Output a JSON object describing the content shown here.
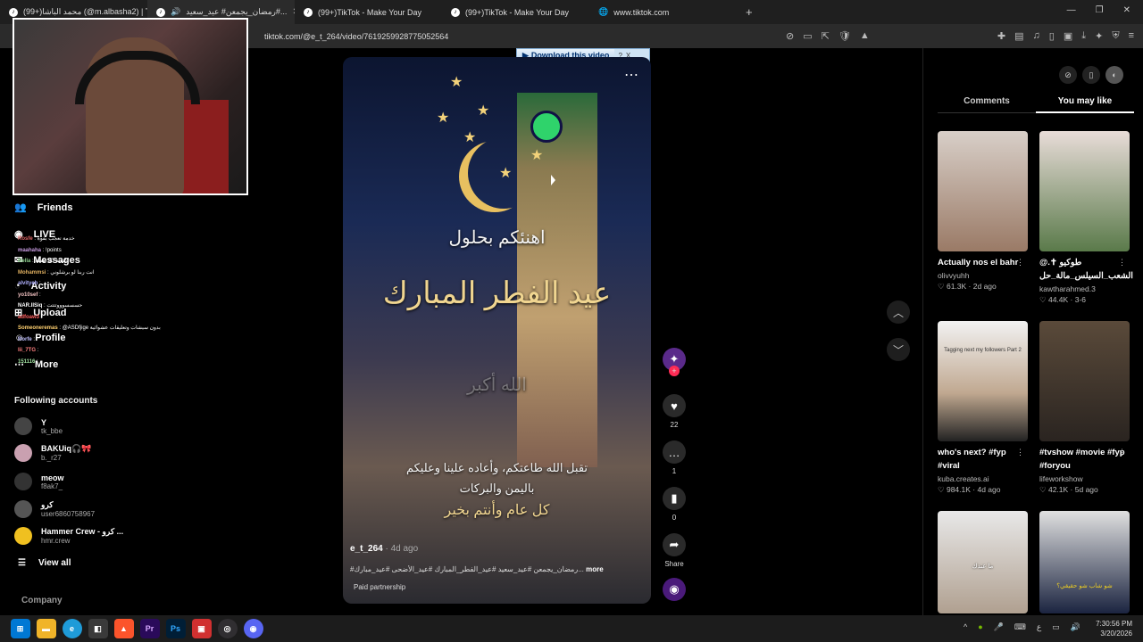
{
  "browser": {
    "tabs": [
      {
        "label": "(99+)محمد الباشا (@m.albasha2) | Tok"
      },
      {
        "label": "رمضان_يجمعن# عيد_سعيد#..."
      },
      {
        "label": "(99+)TikTok - Make Your Day"
      },
      {
        "label": "(99+)TikTok - Make Your Day"
      },
      {
        "label": "www.tiktok.com"
      }
    ],
    "new_tab": "+",
    "url": "tiktok.com/@e_t_264/video/7619259928775052564"
  },
  "downloader": {
    "label": "Download this video",
    "help": "?",
    "close": "X"
  },
  "sidebar": {
    "nav": [
      {
        "label": "Friends"
      },
      {
        "label": "LIVE"
      },
      {
        "label": "Messages"
      },
      {
        "label": "Activity"
      },
      {
        "label": "Upload"
      },
      {
        "label": "Profile"
      },
      {
        "label": "More"
      }
    ],
    "chat": [
      {
        "user": "Rosfe",
        "text": ": خدمة تعجب بقوة"
      },
      {
        "user": "maahaha",
        "text": ": !points"
      },
      {
        "user": "Bella",
        "text": ": كسبة 30 نقطة"
      },
      {
        "user": "Mohammsi",
        "text": ": انت ربنا لو برشلوني"
      },
      {
        "user": "alvityeh",
        "text": ":"
      },
      {
        "user": "yo10sef",
        "text": ":"
      },
      {
        "user": "NAR.IISiq",
        "text": ": حسسسوووتتتت"
      },
      {
        "user": "adfoaw3",
        "text": ":"
      },
      {
        "user": "Someoneremas",
        "text": ": @ASDfjige بدون سيشات وتعليقات عشوائية"
      },
      {
        "user": "Rorfe",
        "text": ":"
      },
      {
        "user": "lii_7TG",
        "text": ":"
      },
      {
        "user": "151116",
        "text": ":"
      }
    ],
    "following_title": "Following accounts",
    "accounts": [
      {
        "name": "Y",
        "handle": "tk_bbe"
      },
      {
        "name": "BAKUiq🎧🎀",
        "handle": "b._r27"
      },
      {
        "name": "meow",
        "handle": "f8ak7_"
      },
      {
        "name": "كرو",
        "handle": "user6860758967"
      },
      {
        "name": "Hammer Crew - كرو ...",
        "handle": "hmr.crew"
      }
    ],
    "view_all": "View all",
    "company": "Company"
  },
  "video": {
    "greeting": "اهنئكم بحلول",
    "eid": "عيد الفطر المبارك",
    "takbir": "الله أكبر",
    "line1": "تقبل الله طاعتكم، وأعاده علينا وعليكم",
    "line2": "باليمن والبركات",
    "line3": "كل عام وأنتم بخير",
    "username": "e_t_264",
    "ago": "· 4d ago",
    "caption": "#رمضان_يجمعن #عيد_سعيد #عيد_الفطر_المبارك #عيد_الأضحى #عيد_مبارك...",
    "more": "more",
    "paid": "Paid partnership"
  },
  "actions": {
    "likes": "22",
    "comments": "1",
    "saves": "0",
    "share": "Share"
  },
  "right_panel": {
    "tabs": [
      "Comments",
      "You may like"
    ],
    "active_tab": "You may like",
    "cards": [
      {
        "title": "Actually nos el bahr",
        "author": "olivvyuhh",
        "meta": "♡ 61.3K · 2d ago",
        "color": "#b89a86"
      },
      {
        "title": "@.✝ طوكيو الشعب_السيلس_مالة_حل",
        "author": "kawtharahmed.3",
        "meta": "♡ 44.4K · 3-6",
        "color": "#c9b9b0"
      },
      {
        "title": "who's next? #fyp #viral",
        "author": "kuba.creates.ai",
        "meta": "♡ 984.1K · 4d ago",
        "color": "#e0d8d0"
      },
      {
        "title": "#tvshow #movie #fyp #foryou",
        "author": "lifeworkshow",
        "meta": "♡ 42.1K · 5d ago",
        "color": "#4a3a30"
      },
      {
        "title": "",
        "author": "",
        "meta": "",
        "color": "#c9c2bc"
      },
      {
        "title": "",
        "author": "",
        "meta": "",
        "color": "#1b2440"
      }
    ],
    "thumb_texts": [
      "",
      "",
      "Tagging next my followers Part 2",
      "",
      "ما عندك",
      "شو شاب شو حقيقي؟"
    ]
  },
  "taskbar": {
    "apps": [
      "start-icon",
      "file-explorer-icon",
      "edge-icon",
      "store-icon",
      "brave-icon",
      "premiere-icon",
      "photoshop-icon",
      "photos-icon",
      "obs-icon",
      "discord-icon"
    ],
    "time": "7:30:56 PM",
    "date": "3/20/2026",
    "lang": "ع"
  }
}
